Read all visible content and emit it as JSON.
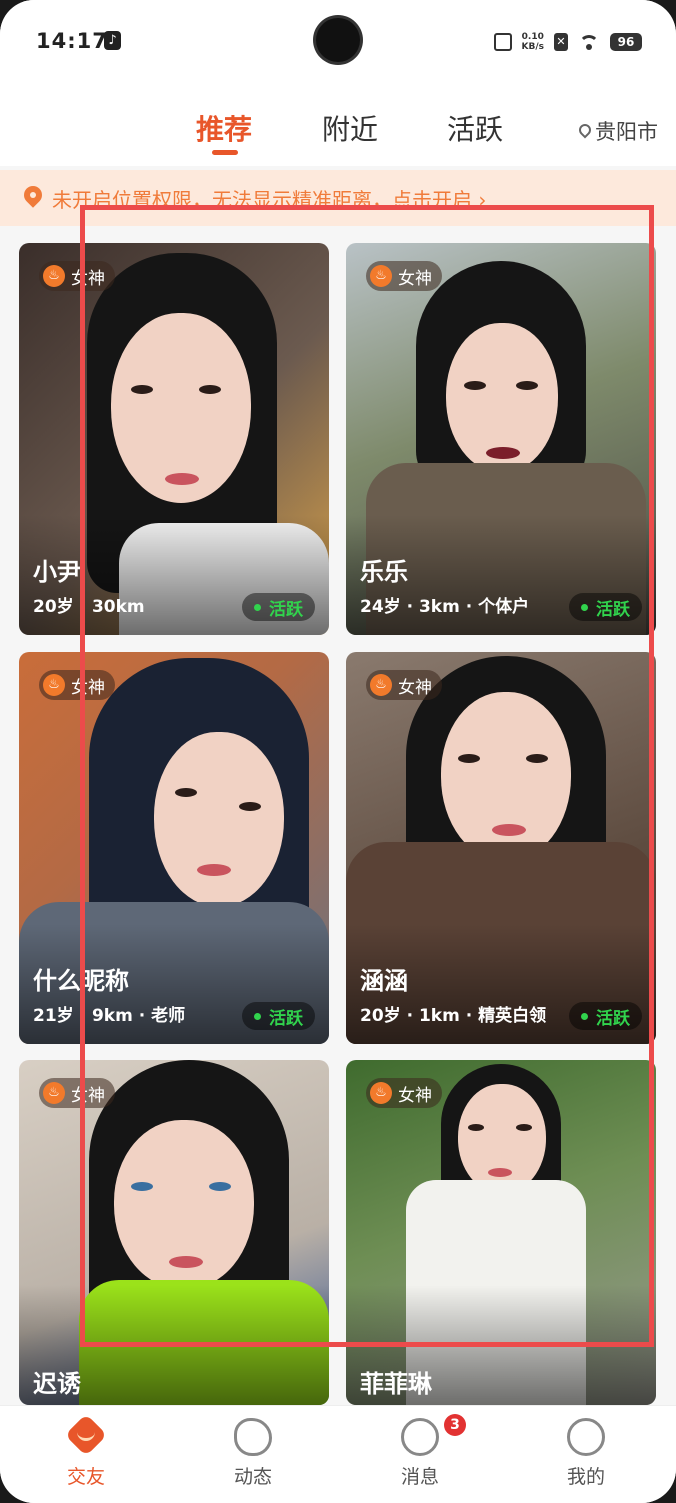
{
  "status_bar": {
    "time": "14:17",
    "net_speed_value": "0.10",
    "net_speed_unit": "KB/s",
    "battery": "96"
  },
  "tabs": [
    {
      "label": "推荐",
      "active": true
    },
    {
      "label": "附近",
      "active": false
    },
    {
      "label": "活跃",
      "active": false
    }
  ],
  "location": {
    "city": "贵阳市",
    "icon": "location-pin-icon"
  },
  "banner": {
    "text": "未开启位置权限，无法显示精准距离，点击开启 ›",
    "color": "#f07b3a"
  },
  "cards": [
    {
      "badge": "女神",
      "name": "小尹",
      "meta": "20岁 · 30km",
      "status": "活跃"
    },
    {
      "badge": "女神",
      "name": "乐乐",
      "meta": "24岁 · 3km · 个体户",
      "status": "活跃"
    },
    {
      "badge": "女神",
      "name": "什么昵称",
      "meta": "21岁 · 9km · 老师",
      "status": "活跃"
    },
    {
      "badge": "女神",
      "name": "涵涵",
      "meta": "20岁 · 1km · 精英白领",
      "status": "活跃"
    },
    {
      "badge": "女神",
      "name": "迟诱",
      "meta": "",
      "status": ""
    },
    {
      "badge": "女神",
      "name": "菲菲琳",
      "meta": "",
      "status": ""
    }
  ],
  "bottom_nav": [
    {
      "label": "交友",
      "icon": "heart-chat-icon",
      "active": true
    },
    {
      "label": "动态",
      "icon": "cloud-face-icon",
      "active": false
    },
    {
      "label": "消息",
      "icon": "chat-bubble-icon",
      "active": false,
      "badge": "3"
    },
    {
      "label": "我的",
      "icon": "smile-face-icon",
      "active": false
    }
  ],
  "colors": {
    "accent": "#e8562a",
    "active_green": "#31d34d",
    "annotation_red": "#ec4b4b"
  }
}
